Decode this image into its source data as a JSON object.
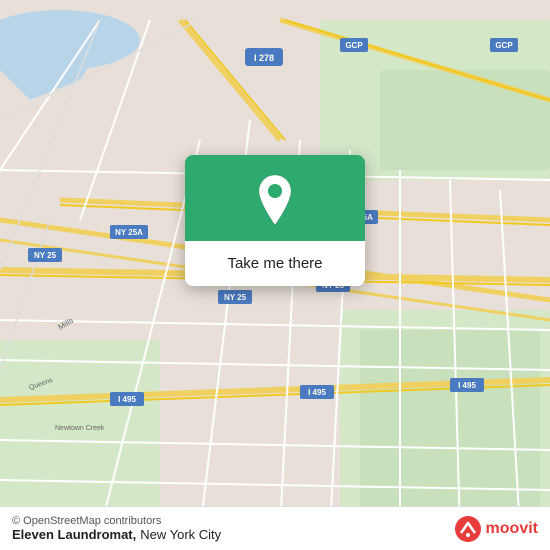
{
  "map": {
    "attribution": "© OpenStreetMap contributors",
    "bg_color": "#e8e0d8"
  },
  "popup": {
    "button_label": "Take me there",
    "pin_color": "#ffffff",
    "bg_color": "#2eaa6e"
  },
  "bottom_bar": {
    "place_name": "Eleven Laundromat,",
    "city": "New York City",
    "copyright": "© OpenStreetMap contributors",
    "moovit_label": "moovit"
  }
}
